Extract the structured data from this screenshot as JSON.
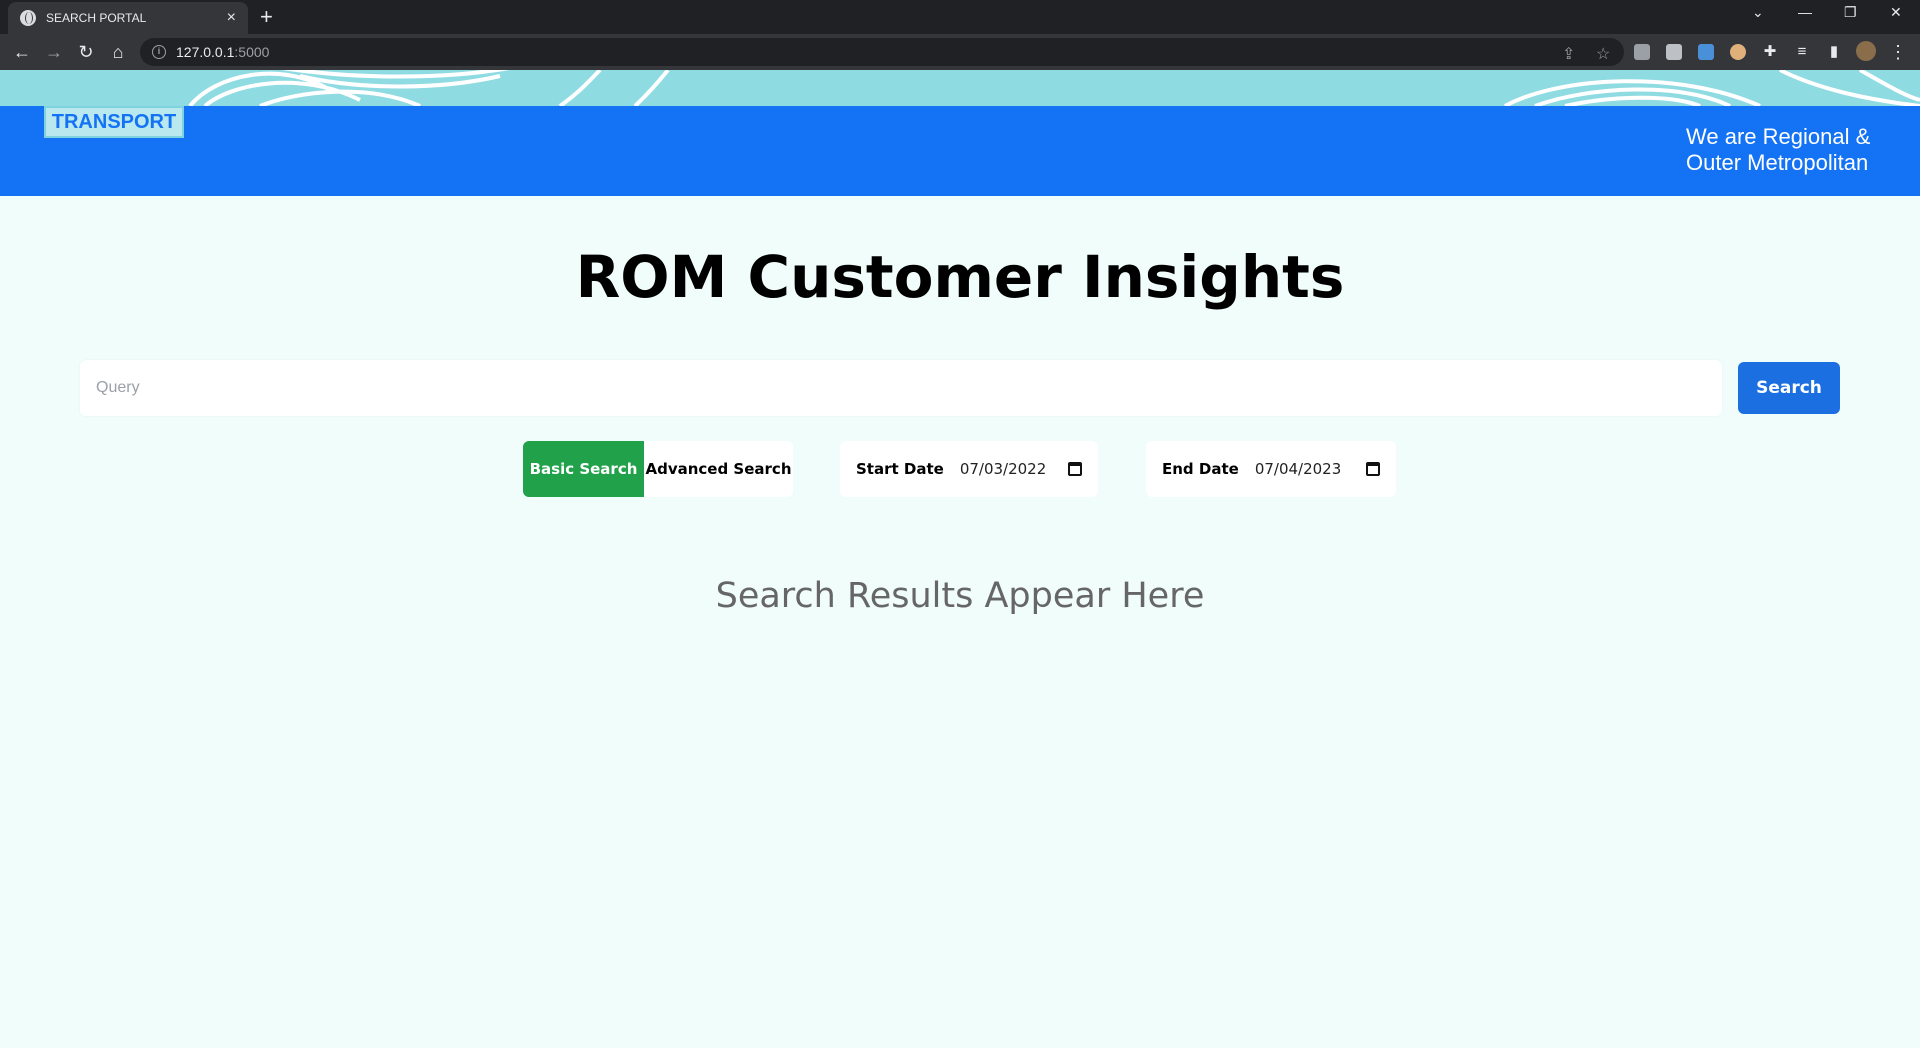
{
  "browser": {
    "tab_title": "SEARCH PORTAL",
    "tab_close": "×",
    "new_tab": "+",
    "url_host": "127.0.0.1",
    "url_port": ":5000"
  },
  "header": {
    "logo_text": "TRANSPORT",
    "tagline_line1": "We are Regional &",
    "tagline_line2": "Outer Metropolitan"
  },
  "main": {
    "title": "ROM Customer Insights",
    "query_placeholder": "Query",
    "query_value": "",
    "search_label": "Search",
    "modes": {
      "basic": "Basic Search",
      "advanced": "Advanced Search",
      "active": "basic"
    },
    "start_date_label": "Start Date",
    "start_date_value": "07/03/2022",
    "end_date_label": "End Date",
    "end_date_value": "07/04/2023",
    "results_placeholder": "Search Results Appear Here"
  },
  "colors": {
    "header_blue": "#1473f5",
    "wave_teal": "#8fdbe2",
    "search_button": "#1c6fe0",
    "basic_active": "#21a14a",
    "page_bg": "#f0fdfa"
  }
}
